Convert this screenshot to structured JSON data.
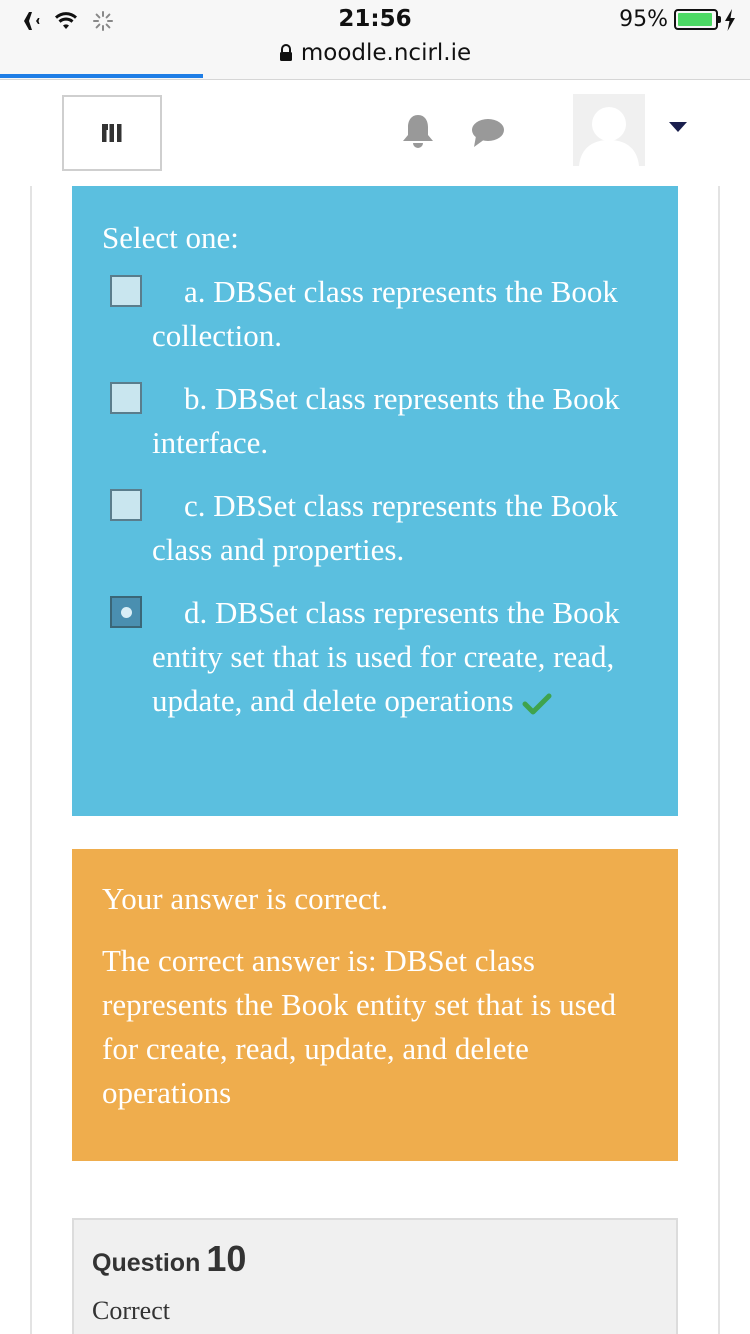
{
  "status_bar": {
    "time": "21:56",
    "battery": "95%",
    "battery_level": 0.95,
    "url": "moodle.ncirl.ie",
    "load_progress": 0.27
  },
  "navbar": {
    "icons": [
      "menu-icon",
      "bell-icon",
      "chat-icon",
      "user-avatar",
      "caret-down-icon"
    ]
  },
  "question": {
    "prompt": "Select one:",
    "options": [
      {
        "label": "a. DBSet class represents the Book collection.",
        "selected": false
      },
      {
        "label": "b. DBSet class represents the Book interface.",
        "selected": false
      },
      {
        "label": "c. DBSet class represents the Book class and properties.",
        "selected": false
      },
      {
        "label": "d. DBSet class represents the Book entity set that is used for create, read, update, and delete operations",
        "selected": true
      }
    ]
  },
  "feedback": {
    "result": "Your answer is correct.",
    "correct_answer": "The correct answer is: DBSet class represents the Book entity set that is used for create, read, update, and delete operations"
  },
  "next_question": {
    "label": "Question",
    "number": "10",
    "state": "Correct"
  },
  "colors": {
    "answer_bg": "#5bbfdf",
    "feedback_bg": "#efad4d",
    "correct_check": "#3fa34d",
    "progress": "#1f7ee6"
  }
}
